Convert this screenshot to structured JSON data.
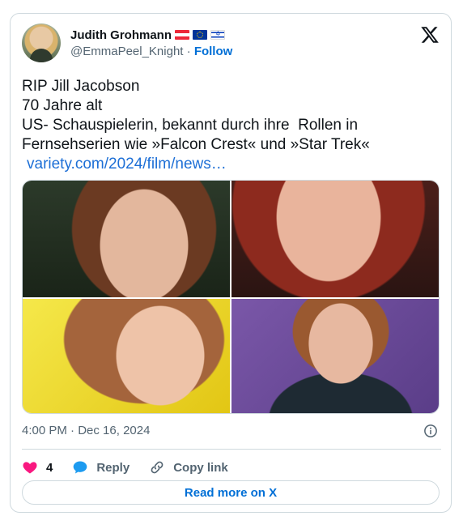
{
  "author": {
    "display_name": "Judith Grohmann",
    "handle": "@EmmaPeel_Knight",
    "separator": "·",
    "follow_label": "Follow",
    "flags": [
      "austria-flag",
      "eu-flag",
      "israel-flag"
    ]
  },
  "tweet": {
    "lines": [
      "RIP Jill Jacobson",
      "70 Jahre alt",
      "US- Schauspielerin, bekannt durch ihre  Rollen in",
      "Fernsehserien wie »Falcon Crest« und »Star Trek«"
    ],
    "link": "variety.com/2024/film/news…"
  },
  "media": {
    "photos": [
      "portrait-photo-1",
      "portrait-photo-2",
      "portrait-photo-3",
      "portrait-photo-4"
    ]
  },
  "meta": {
    "time": "4:00 PM",
    "separator": "·",
    "date": "Dec 16, 2024"
  },
  "actions": {
    "likes_count": "4",
    "reply_label": "Reply",
    "copy_link_label": "Copy link"
  },
  "footer": {
    "read_more_label": "Read more on X"
  },
  "colors": {
    "accent": "#006fd6",
    "link": "#1d6fd6",
    "like": "#f91880",
    "reply_icon": "#1d9bf0",
    "muted": "#536471",
    "border": "#cfd9de"
  }
}
